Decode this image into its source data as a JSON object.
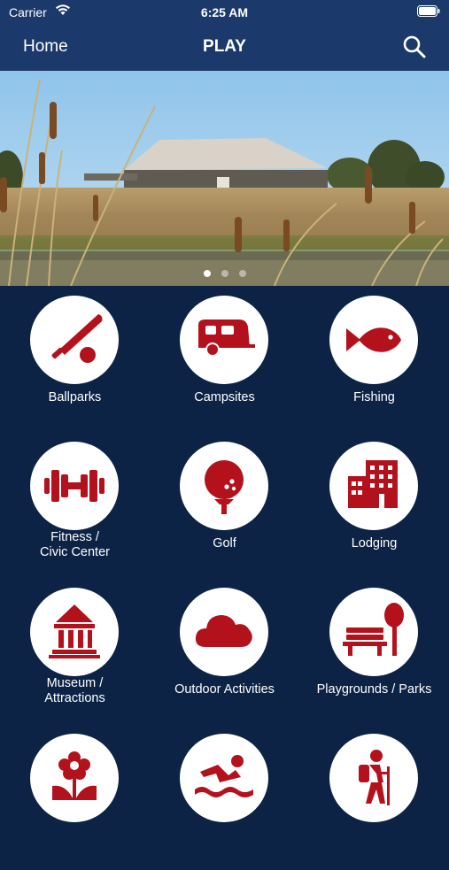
{
  "status_bar": {
    "carrier": "Carrier",
    "time": "6:25 AM"
  },
  "navbar": {
    "back_label": "Home",
    "title": "PLAY",
    "search_icon": "search-icon"
  },
  "hero": {
    "slides": 3,
    "active_slide": 1,
    "image_description_icon": "building-landscape-photo"
  },
  "colors": {
    "nav": "#1b3a6b",
    "background": "#0c2346",
    "icon_red": "#b3121d",
    "circle": "#ffffff"
  },
  "categories": [
    {
      "label": "Ballparks",
      "icon": "baseball-bat-icon"
    },
    {
      "label": "Campsites",
      "icon": "camper-trailer-icon"
    },
    {
      "label": "Fishing",
      "icon": "fish-icon"
    },
    {
      "label": "Fitness /\nCivic Center",
      "icon": "dumbbell-icon"
    },
    {
      "label": "Golf",
      "icon": "golf-ball-icon"
    },
    {
      "label": "Lodging",
      "icon": "hotel-building-icon"
    },
    {
      "label": "Museum /\nAttractions",
      "icon": "museum-icon"
    },
    {
      "label": "Outdoor Activities",
      "icon": "cloud-icon"
    },
    {
      "label": "Playgrounds / Parks",
      "icon": "park-bench-tree-icon"
    },
    {
      "label": "",
      "icon": "flower-icon"
    },
    {
      "label": "",
      "icon": "swimmer-icon"
    },
    {
      "label": "",
      "icon": "hiker-icon"
    }
  ]
}
